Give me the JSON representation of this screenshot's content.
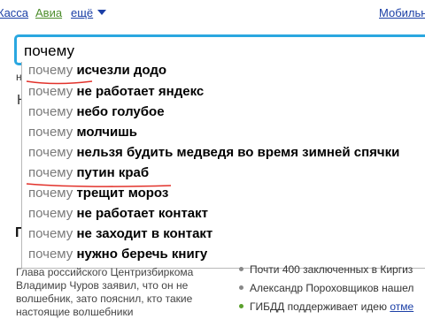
{
  "nav": {
    "kassa": "Касса",
    "avia": "Авиа",
    "more": "ещё",
    "mobile": "Мобильн"
  },
  "search": {
    "value": "почему"
  },
  "background": {
    "frag_h": "н",
    "frag_h2": "Н",
    "frag_n": "П"
  },
  "suggestions": [
    {
      "prefix": "почему",
      "suffix": "исчезли додо"
    },
    {
      "prefix": "почему",
      "suffix": "не работает яндекс"
    },
    {
      "prefix": "почему",
      "suffix": "небо голубое"
    },
    {
      "prefix": "почему",
      "suffix": "молчишь"
    },
    {
      "prefix": "почему",
      "suffix": "нельзя будить медведя во время зимней спячки"
    },
    {
      "prefix": "почему",
      "suffix": "путин краб"
    },
    {
      "prefix": "почему",
      "suffix": "трещит мороз"
    },
    {
      "prefix": "почему",
      "suffix": "не работает контакт"
    },
    {
      "prefix": "почему",
      "suffix": "не заходит в контакт"
    },
    {
      "prefix": "почему",
      "suffix": "нужно беречь книгу"
    }
  ],
  "news_left": {
    "lines": [
      "Глава российского Центризбиркома",
      "Владимир Чуров заявил, что он не",
      "волшебник, зато пояснил, кто такие",
      "настоящие волшебники"
    ]
  },
  "news_right": [
    {
      "text": "Почти 400 заключенных в Киргиз"
    },
    {
      "text": "Александр Пороховщиков нашел"
    },
    {
      "text": "ГИБДД поддерживает идею",
      "link": "отме"
    }
  ],
  "colors": {
    "search_border": "#2aa7e0",
    "underline_red": "#e2322b",
    "link_blue": "#1b3fa6",
    "link_green": "#4c8d2b"
  }
}
